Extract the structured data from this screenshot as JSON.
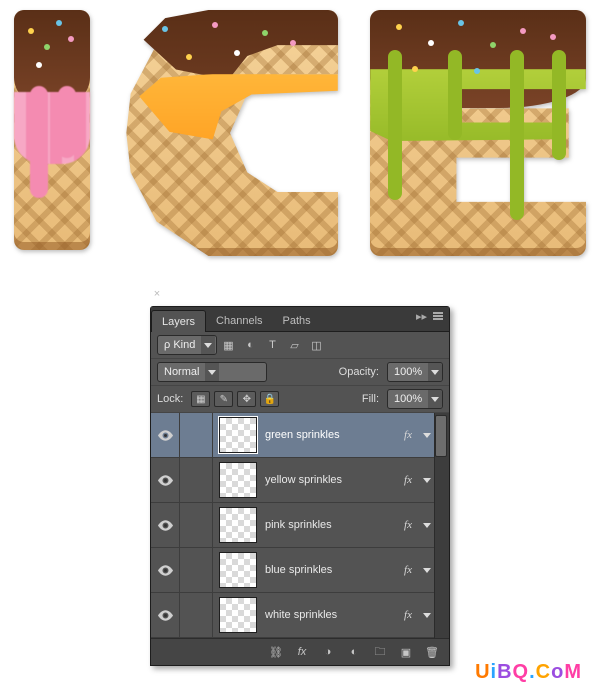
{
  "artwork": {
    "text": "ICE"
  },
  "panel": {
    "tabs": [
      "Layers",
      "Channels",
      "Paths"
    ],
    "active_tab": 0,
    "filter": {
      "label": "Kind",
      "value": ""
    },
    "blend": {
      "mode": "Normal",
      "opacity_label": "Opacity:",
      "opacity_value": "100%"
    },
    "lock": {
      "label": "Lock:",
      "fill_label": "Fill:",
      "fill_value": "100%"
    },
    "layers": [
      {
        "name": "green sprinkles",
        "visible": true,
        "fx": true,
        "selected": true
      },
      {
        "name": "yellow sprinkles",
        "visible": true,
        "fx": true,
        "selected": false
      },
      {
        "name": "pink sprinkles",
        "visible": true,
        "fx": true,
        "selected": false
      },
      {
        "name": "blue sprinkles",
        "visible": true,
        "fx": true,
        "selected": false
      },
      {
        "name": "white sprinkles",
        "visible": true,
        "fx": true,
        "selected": false
      }
    ],
    "fx_label": "fx"
  },
  "watermark": {
    "text": "UiBQ.CoM",
    "colors": [
      "#ff7a00",
      "#29a3ff",
      "#9b4de0",
      "#ff3ea5",
      "#29a3ff",
      "#ffa300",
      "#9b4de0",
      "#ff3ea5"
    ]
  }
}
